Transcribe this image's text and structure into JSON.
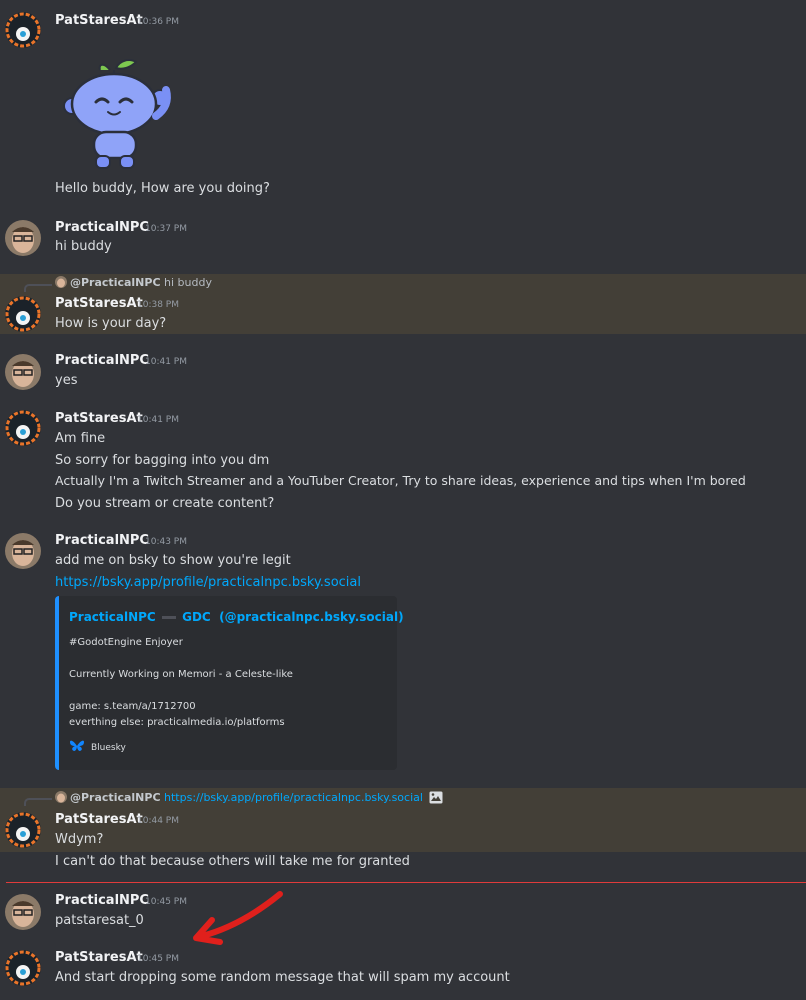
{
  "messages": {
    "m1": {
      "author": "PatStaresAt",
      "time": "10:36 PM",
      "sticker": "wumpus-waving-sticker",
      "text": "Hello buddy, How are you doing?"
    },
    "m2": {
      "author": "PracticalNPC",
      "time": "10:37 PM",
      "text": "hi buddy"
    },
    "m3": {
      "reply_author": "@PracticalNPC",
      "reply_text": "hi buddy",
      "author": "PatStaresAt",
      "time": "10:38 PM",
      "text": "How is your day?"
    },
    "m4": {
      "author": "PracticalNPC",
      "time": "10:41 PM",
      "text": "yes"
    },
    "m5": {
      "author": "PatStaresAt",
      "time": "10:41 PM",
      "lines": [
        "Am fine",
        "So sorry for bagging into you dm",
        "Actually I'm a Twitch Streamer and a YouTuber Creator, Try to share ideas, experience and tips when I'm bored",
        "Do you stream or create content?"
      ]
    },
    "m6": {
      "author": "PracticalNPC",
      "time": "10:43 PM",
      "text": "add me on bsky to show you're legit",
      "link": "https://bsky.app/profile/practicalnpc.bsky.social"
    },
    "m7": {
      "reply_author": "@PracticalNPC",
      "reply_link": "https://bsky.app/profile/practicalnpc.bsky.social",
      "reply_icon": "image-icon",
      "author": "PatStaresAt",
      "time": "10:44 PM",
      "lines": [
        "Wdym?",
        "I can't do that because others will take me for granted"
      ]
    },
    "m8": {
      "author": "PracticalNPC",
      "time": "10:45 PM",
      "text": "patstaresat_0"
    },
    "m9": {
      "author": "PatStaresAt",
      "time": "10:45 PM",
      "text": "And start dropping some random message that will spam my account"
    }
  },
  "embed": {
    "title_name": "PracticalNPC",
    "title_org": "GDC",
    "title_handle": "(@practicalnpc.bsky.social)",
    "line1": "#GodotEngine Enjoyer",
    "line2": "Currently Working on Memori - a Celeste-like",
    "line3": "game: s.team/a/1712700",
    "line4": "everthing else: practicalmedia.io/platforms",
    "provider": "Bluesky",
    "provider_icon": "butterfly-icon",
    "accent": "#1e90ff"
  },
  "colors": {
    "background": "#313338",
    "highlight": "#433f37",
    "link": "#00a8fc",
    "new_divider": "#e03b3b",
    "annotation_arrow": "#e0201c"
  }
}
